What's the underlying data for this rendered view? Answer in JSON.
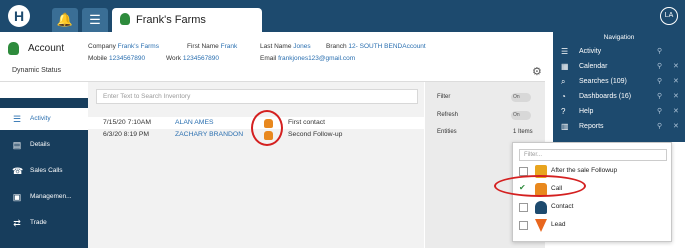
{
  "topbar": {
    "logo_letter": "H",
    "tab_title": "Frank's Farms",
    "avatar_initials": "LA"
  },
  "account": {
    "title": "Account",
    "status_label": "Dynamic Status",
    "company_label": "Company",
    "company_value": "Frank's Farms",
    "first_name_label": "First Name",
    "first_name_value": "Frank",
    "last_name_label": "Last Name",
    "last_name_value": "Jones",
    "branch_label": "Branch",
    "branch_value": "12- SOUTH BENDAccount",
    "mobile_label": "Mobile",
    "mobile_value": "1234567890",
    "work_label": "Work",
    "work_value": "1234567890",
    "email_label": "Email",
    "email_value": "frankjones123@gmail.com"
  },
  "sidebar": {
    "items": [
      {
        "label": "Activity",
        "icon": "list-icon"
      },
      {
        "label": "Details",
        "icon": "document-icon"
      },
      {
        "label": "Sales Calls",
        "icon": "phone-icon"
      },
      {
        "label": "Managemen...",
        "icon": "management-icon"
      },
      {
        "label": "Trade",
        "icon": "trade-icon"
      }
    ]
  },
  "main": {
    "search_placeholder": "Enter Text to Search Inventory",
    "rows": [
      {
        "date": "7/15/20 7:10AM",
        "name": "ALAN AMES",
        "subject": "First contact"
      },
      {
        "date": "6/3/20 8:19 PM",
        "name": "ZACHARY BRANDON",
        "subject": "Second Follow-up"
      }
    ]
  },
  "filters": {
    "filter_label": "Filter",
    "filter_toggle": "On",
    "refresh_label": "Refresh",
    "refresh_toggle": "On",
    "entities_label": "Entities",
    "entities_count": "1 Items"
  },
  "dropdown": {
    "filter_placeholder": "Filter...",
    "items": [
      {
        "label": "After the sale Followup",
        "checked": false,
        "icon": "followup-icon"
      },
      {
        "label": "Call",
        "checked": true,
        "icon": "phone-icon"
      },
      {
        "label": "Contact",
        "checked": false,
        "icon": "person-icon"
      },
      {
        "label": "Lead",
        "checked": false,
        "icon": "funnel-icon"
      }
    ]
  },
  "navigation": {
    "title": "Navigation",
    "items": [
      {
        "label": "Activity",
        "icon": "list-icon"
      },
      {
        "label": "Calendar",
        "icon": "calendar-icon"
      },
      {
        "label": "Searches (109)",
        "icon": "search-icon"
      },
      {
        "label": "Dashboards (16)",
        "icon": "dashboard-icon"
      },
      {
        "label": "Help",
        "icon": "help-icon"
      },
      {
        "label": "Reports",
        "icon": "reports-icon"
      }
    ]
  },
  "colors": {
    "brand_dark": "#1d4a6e",
    "sidebar": "#173d5c",
    "link": "#2a6fb0",
    "phone_orange": "#e8881e",
    "highlight_red": "#d42020",
    "leaf_green": "#2e8b3c"
  }
}
